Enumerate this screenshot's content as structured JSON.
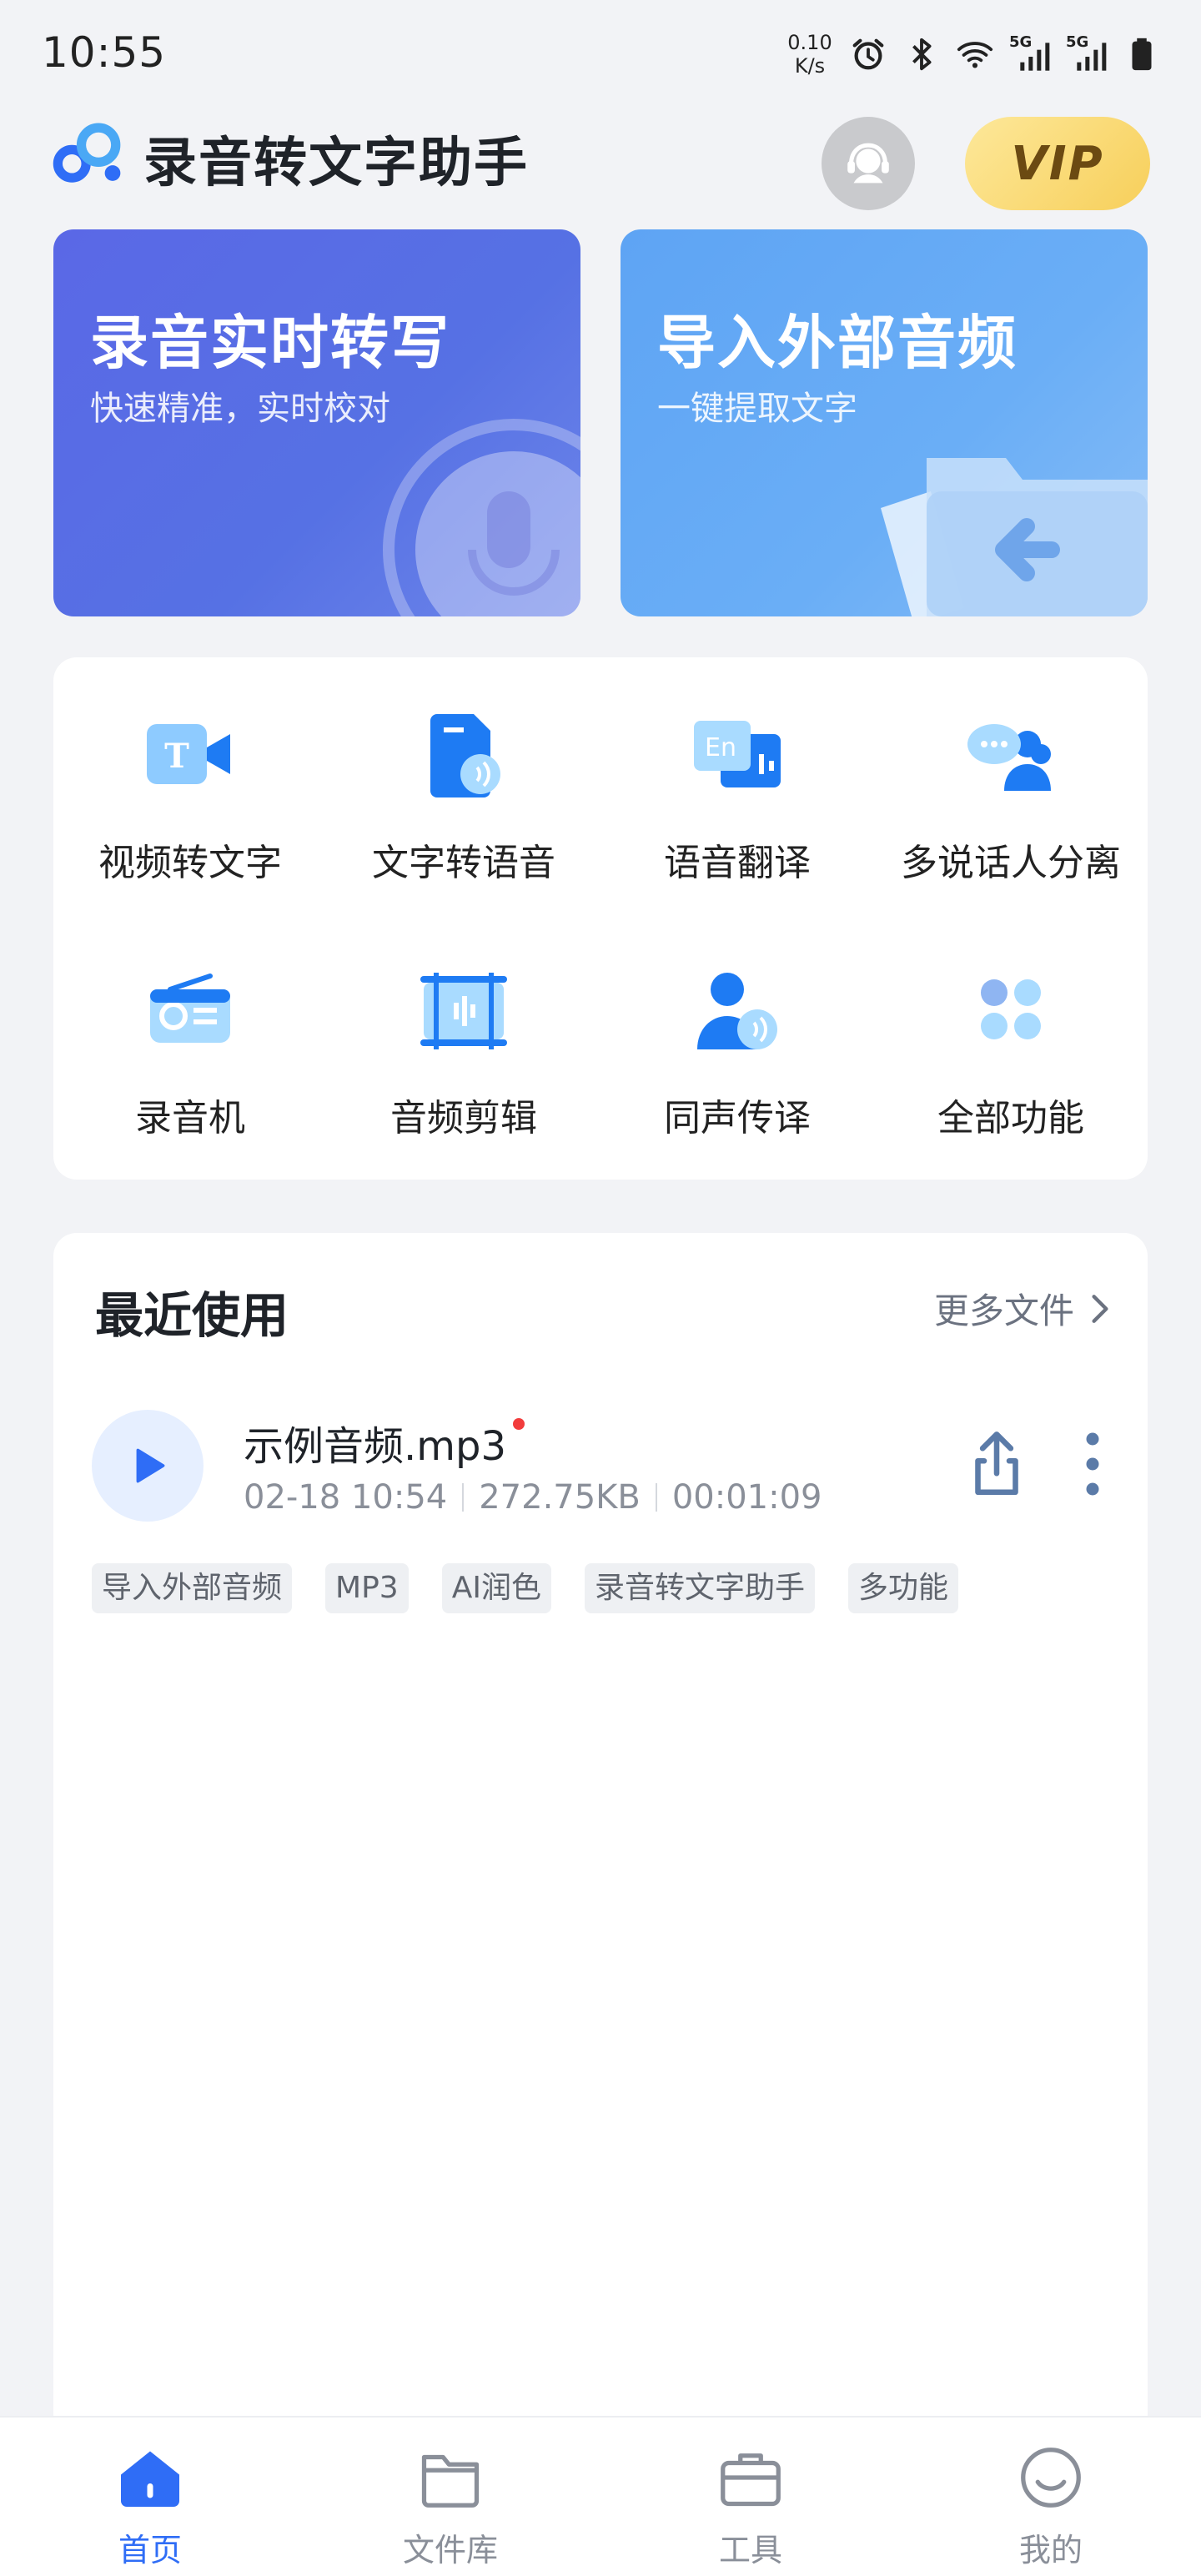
{
  "status_bar": {
    "time": "10:55",
    "net_speed_value": "0.10",
    "net_speed_unit": "K/s",
    "signal_1": "5G",
    "signal_2": "5G"
  },
  "header": {
    "title": "录音转文字助手",
    "vip_label": "VIP"
  },
  "hero": [
    {
      "title": "录音实时转写",
      "subtitle": "快速精准，实时校对"
    },
    {
      "title": "导入外部音频",
      "subtitle": "一键提取文字"
    }
  ],
  "features": [
    {
      "label": "视频转文字",
      "icon": "video-to-text-icon"
    },
    {
      "label": "文字转语音",
      "icon": "text-to-speech-icon"
    },
    {
      "label": "语音翻译",
      "icon": "voice-translate-icon"
    },
    {
      "label": "多说话人分离",
      "icon": "speaker-separation-icon"
    },
    {
      "label": "录音机",
      "icon": "recorder-icon"
    },
    {
      "label": "音频剪辑",
      "icon": "audio-edit-icon"
    },
    {
      "label": "同声传译",
      "icon": "simultaneous-interpret-icon"
    },
    {
      "label": "全部功能",
      "icon": "all-features-icon"
    }
  ],
  "recent": {
    "title": "最近使用",
    "more_label": "更多文件",
    "file": {
      "name": "示例音频.mp3",
      "date": "02-18 10:54",
      "size": "272.75KB",
      "duration": "00:01:09"
    },
    "tags": [
      "导入外部音频",
      "MP3",
      "AI润色",
      "录音转文字助手",
      "多功能"
    ]
  },
  "nav": [
    {
      "label": "首页",
      "active": true
    },
    {
      "label": "文件库",
      "active": false
    },
    {
      "label": "工具",
      "active": false
    },
    {
      "label": "我的",
      "active": false
    }
  ],
  "colors": {
    "accent": "#2f6df6",
    "hero_record": "#5a68e6",
    "hero_import": "#5ea4f4",
    "vip": "#f7cf5a",
    "unread_dot": "#f23c3c"
  }
}
